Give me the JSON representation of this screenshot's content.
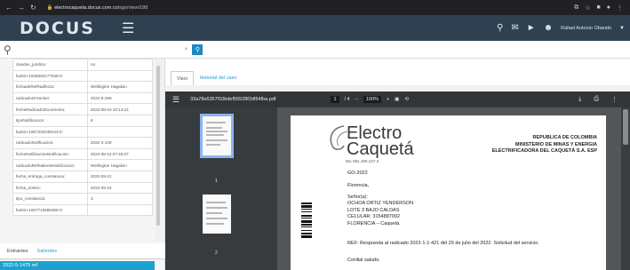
{
  "browser": {
    "url_host": "electrocaqueta.docus.com.co",
    "url_path": "/sgo/view/188"
  },
  "header": {
    "logo": "DOCUS",
    "user": "Rafael Antonio Obando"
  },
  "props": [
    [
      "clsedev_juridica:",
      "no"
    ],
    [
      "button-1636603177048-0:",
      ""
    ],
    [
      "fechadeRefRadfecta:",
      "Wellington Hagalion"
    ],
    [
      "radicadoOrSocket:",
      "2022-5-299"
    ],
    [
      "fechaRadicadoDocumento:",
      "2022-08-03 10:14:24"
    ],
    [
      "tipoNotificacion:",
      "8"
    ],
    [
      "button-1657332048143-0:",
      ""
    ],
    [
      "radicadoNotificacion:",
      "2022-4-149"
    ],
    [
      "fechaNotificacionNotificacion:",
      "2022-08-12 07:26:37"
    ],
    [
      "radicadoRefSalienteNotificacion:",
      "Wellington Hagalion"
    ],
    [
      "fecha_entrega_constancia:",
      "2022-09-12"
    ],
    [
      "fecha_sorteo:",
      "2022-09-16"
    ],
    [
      "tipo_constancia:",
      "3"
    ],
    [
      "button-1657715986386-0:",
      ""
    ]
  ],
  "left_tabs": [
    "Entrantes",
    "Salientes"
  ],
  "left_selected": "2022-5-1475 ref",
  "content_tabs": [
    "Visor",
    "Historial del caso"
  ],
  "pdf": {
    "file": "33a78e6357f10bdef55528f2df54fba.pdf",
    "page": "1",
    "pages": "/ 4",
    "zoom": "100%",
    "thumb_labels": [
      "1",
      "2"
    ]
  },
  "letter": {
    "logo1": "Electro",
    "logo2": "Caquetá",
    "logo3": "NIL 891.190.127-3",
    "rep": [
      "REPUBLICA DE COLOMBIA",
      "MINISTERIO DE MINAS Y ENERGIA",
      "ELECTRIFICADORA DEL CAQUETÁ S.A.  ESP"
    ],
    "ref_code": "GO-2022",
    "city": "Florencia,",
    "salutation": "Señor(a):",
    "addr": [
      "OCHOA ORTIZ YENDERSON",
      "LOTE 3 BAJO CALDAS",
      "CELULAR: 3154887092",
      "FLORENCIA – Caquetá."
    ],
    "ref": "REF: Respuesta al radicado 2022-1-1-421 del 29 de julio del 2022. Solicitud del servicio.",
    "greet": "Cordial saludo."
  },
  "colors": {
    "header": "#2f4150",
    "accent": "#1aa3cf"
  }
}
